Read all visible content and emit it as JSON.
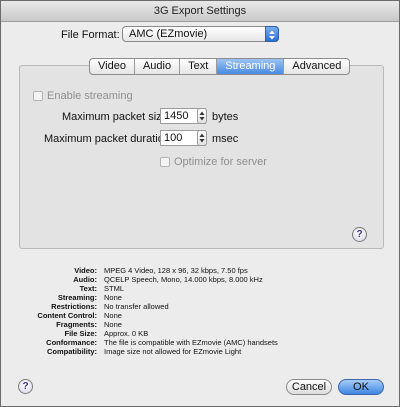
{
  "window": {
    "title": "3G Export Settings"
  },
  "format": {
    "label": "File Format:",
    "value": "AMC (EZmovie)"
  },
  "tabs": [
    {
      "label": "Video",
      "active": false
    },
    {
      "label": "Audio",
      "active": false
    },
    {
      "label": "Text",
      "active": false
    },
    {
      "label": "Streaming",
      "active": true
    },
    {
      "label": "Advanced",
      "active": false
    }
  ],
  "streaming": {
    "enable_label": "Enable streaming",
    "enable_checked": false,
    "packet_size_label": "Maximum packet size:",
    "packet_size_value": "1450",
    "packet_size_unit": "bytes",
    "packet_duration_label": "Maximum packet duration:",
    "packet_duration_value": "100",
    "packet_duration_unit": "msec",
    "optimize_label": "Optimize for server",
    "optimize_checked": false
  },
  "summary": [
    {
      "key": "Video:",
      "value": "MPEG 4 Video, 128 x 96, 32 kbps, 7.50 fps"
    },
    {
      "key": "Audio:",
      "value": "QCELP Speech, Mono, 14.000 kbps, 8.000 kHz"
    },
    {
      "key": "Text:",
      "value": "STML"
    },
    {
      "key": "Streaming:",
      "value": "None"
    },
    {
      "key": "Restrictions:",
      "value": "No transfer allowed"
    },
    {
      "key": "Content Control:",
      "value": "None"
    },
    {
      "key": "Fragments:",
      "value": "None"
    },
    {
      "key": "File Size:",
      "value": "Approx. 0 KB"
    },
    {
      "key": "Conformance:",
      "value": "The file is compatible with EZmovie (AMC) handsets"
    },
    {
      "key": "Compatibility:",
      "value": "Image size not allowed for EZmovie Light"
    }
  ],
  "buttons": {
    "help": "?",
    "cancel": "Cancel",
    "ok": "OK"
  },
  "colors": {
    "accent": "#3f86e3",
    "disabled_text": "#8f8f8f"
  }
}
